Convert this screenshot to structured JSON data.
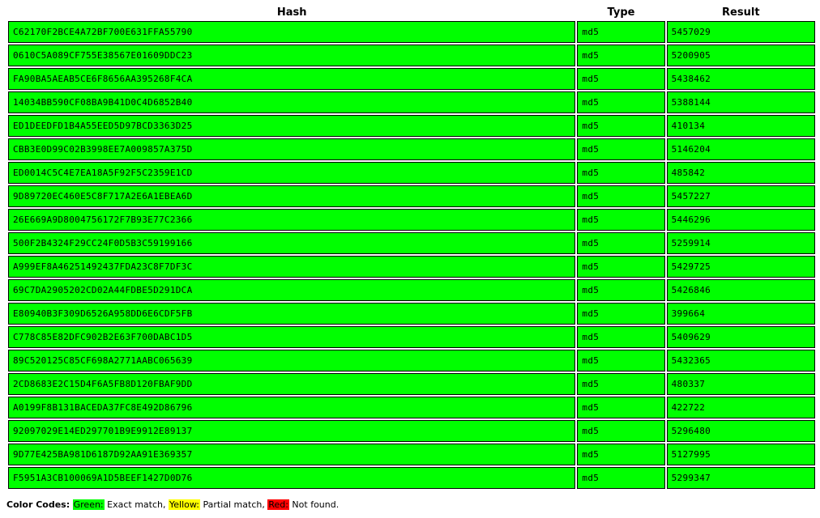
{
  "colors": {
    "exact": "#00ff00",
    "partial": "#ffff00",
    "not_found": "#ff0000"
  },
  "table": {
    "headers": {
      "hash": "Hash",
      "type": "Type",
      "result": "Result"
    },
    "rows": [
      {
        "hash": "C62170F2BCE4A72BF700E631FFA55790",
        "type": "md5",
        "result": "5457029",
        "status": "exact"
      },
      {
        "hash": "0610C5A089CF755E38567E01609DDC23",
        "type": "md5",
        "result": "5200905",
        "status": "exact"
      },
      {
        "hash": "FA90BA5AEAB5CE6F8656AA395268F4CA",
        "type": "md5",
        "result": "5438462",
        "status": "exact"
      },
      {
        "hash": "14034BB590CF08BA9B41D0C4D6852B40",
        "type": "md5",
        "result": "5388144",
        "status": "exact"
      },
      {
        "hash": "ED1DEEDFD1B4A55EED5D97BCD3363D25",
        "type": "md5",
        "result": "410134",
        "status": "exact"
      },
      {
        "hash": "CBB3E0D99C02B3998EE7A009857A375D",
        "type": "md5",
        "result": "5146204",
        "status": "exact"
      },
      {
        "hash": "ED0014C5C4E7EA18A5F92F5C2359E1CD",
        "type": "md5",
        "result": "485842",
        "status": "exact"
      },
      {
        "hash": "9D89720EC460E5C8F717A2E6A1EBEA6D",
        "type": "md5",
        "result": "5457227",
        "status": "exact"
      },
      {
        "hash": "26E669A9D8004756172F7B93E77C2366",
        "type": "md5",
        "result": "5446296",
        "status": "exact"
      },
      {
        "hash": "500F2B4324F29CC24F0D5B3C59199166",
        "type": "md5",
        "result": "5259914",
        "status": "exact"
      },
      {
        "hash": "A999EF8A46251492437FDA23C8F7DF3C",
        "type": "md5",
        "result": "5429725",
        "status": "exact"
      },
      {
        "hash": "69C7DA2905202CD02A44FDBE5D291DCA",
        "type": "md5",
        "result": "5426846",
        "status": "exact"
      },
      {
        "hash": "E80940B3F309D6526A958DD6E6CDF5FB",
        "type": "md5",
        "result": "399664",
        "status": "exact"
      },
      {
        "hash": "C778C85E82DFC902B2E63F700DABC1D5",
        "type": "md5",
        "result": "5409629",
        "status": "exact"
      },
      {
        "hash": "89C520125C85CF698A2771AABC065639",
        "type": "md5",
        "result": "5432365",
        "status": "exact"
      },
      {
        "hash": "2CD8683E2C15D4F6A5FB8D120FBAF9DD",
        "type": "md5",
        "result": "480337",
        "status": "exact"
      },
      {
        "hash": "A0199F8B131BACEDA37FC8E492D86796",
        "type": "md5",
        "result": "422722",
        "status": "exact"
      },
      {
        "hash": "92097029E14ED297701B9E9912E89137",
        "type": "md5",
        "result": "5296480",
        "status": "exact"
      },
      {
        "hash": "9D77E425BA981D6187D92AA91E369357",
        "type": "md5",
        "result": "5127995",
        "status": "exact"
      },
      {
        "hash": "F5951A3CB100069A1D5BEEF1427D0D76",
        "type": "md5",
        "result": "5299347",
        "status": "exact"
      }
    ]
  },
  "legend": {
    "title": "Color Codes:",
    "green_label": "Green:",
    "green_text": " Exact match, ",
    "yellow_label": "Yellow:",
    "yellow_text": " Partial match, ",
    "red_label": "Red:",
    "red_text": " Not found."
  }
}
